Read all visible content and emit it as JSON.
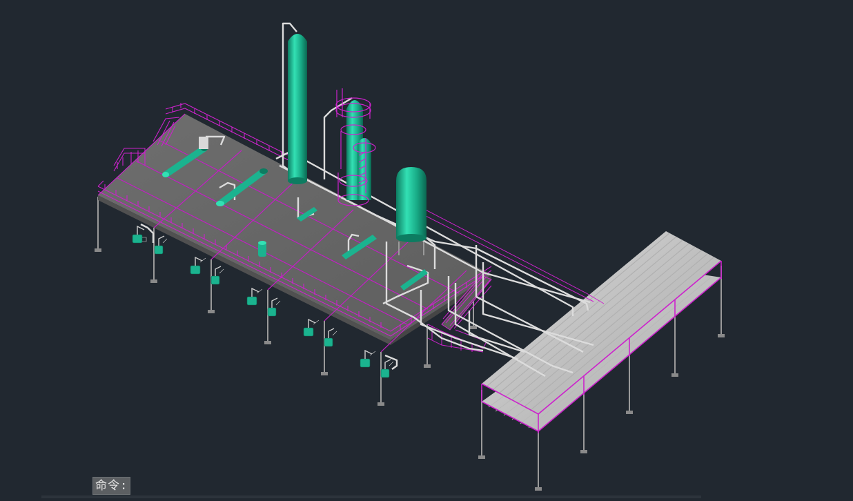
{
  "command_line": {
    "prompt_label": "命令:"
  },
  "viewport": {
    "background_color": "#212830",
    "colors": {
      "equipment": "#1bb38f",
      "railing": "#cc22cc",
      "deck": "#6a6a6a",
      "pipe": "#d9d9d9",
      "column": "#9a9a9a"
    }
  }
}
